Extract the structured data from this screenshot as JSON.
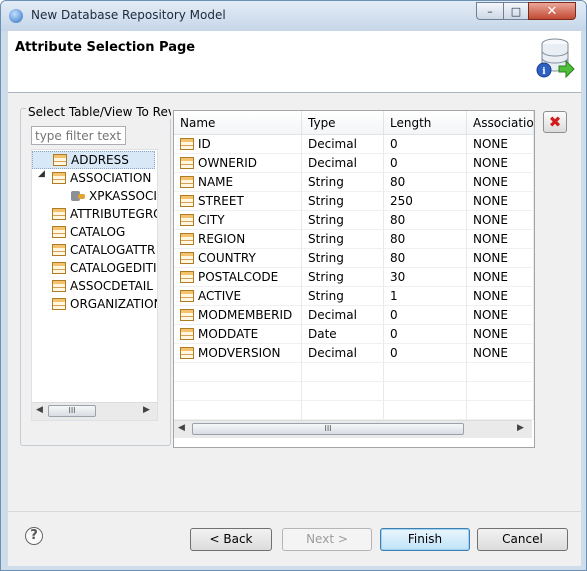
{
  "window": {
    "title": "New Database Repository Model",
    "controls": {
      "minimize": "–",
      "maximize": "□",
      "close": "✕"
    }
  },
  "header": {
    "page_title": "Attribute Selection Page"
  },
  "left_panel": {
    "group_label": "Select Table/View To Revi",
    "filter_placeholder": "type filter text",
    "tree": [
      {
        "label": "ADDRESS",
        "icon": "table-icon",
        "selected": true,
        "level": 0
      },
      {
        "label": "ASSOCIATION",
        "icon": "table-icon",
        "expanded": true,
        "level": 0
      },
      {
        "label": "XPKASSOCI",
        "icon": "key-index-icon",
        "level": 1
      },
      {
        "label": "ATTRIBUTEGRO",
        "icon": "table-icon",
        "level": 0
      },
      {
        "label": "CATALOG",
        "icon": "table-icon",
        "level": 0
      },
      {
        "label": "CATALOGATTR",
        "icon": "table-icon",
        "level": 0
      },
      {
        "label": "CATALOGEDITI",
        "icon": "table-icon",
        "level": 0
      },
      {
        "label": "ASSOCDETAIL",
        "icon": "table-icon",
        "level": 0
      },
      {
        "label": "ORGANIZATION",
        "icon": "table-icon",
        "level": 0
      }
    ],
    "scrollbar_grip": "III"
  },
  "table": {
    "columns": [
      "Name",
      "Type",
      "Length",
      "Association"
    ],
    "rows": [
      [
        "ID",
        "Decimal",
        "0",
        "NONE"
      ],
      [
        "OWNERID",
        "Decimal",
        "0",
        "NONE"
      ],
      [
        "NAME",
        "String",
        "80",
        "NONE"
      ],
      [
        "STREET",
        "String",
        "250",
        "NONE"
      ],
      [
        "CITY",
        "String",
        "80",
        "NONE"
      ],
      [
        "REGION",
        "String",
        "80",
        "NONE"
      ],
      [
        "COUNTRY",
        "String",
        "80",
        "NONE"
      ],
      [
        "POSTALCODE",
        "String",
        "30",
        "NONE"
      ],
      [
        "ACTIVE",
        "String",
        "1",
        "NONE"
      ],
      [
        "MODMEMBERID",
        "Decimal",
        "0",
        "NONE"
      ],
      [
        "MODDATE",
        "Date",
        "0",
        "NONE"
      ],
      [
        "MODVERSION",
        "Decimal",
        "0",
        "NONE"
      ]
    ],
    "scrollbar_grip": "III"
  },
  "remove_button": {
    "icon": "remove-red-x-icon",
    "glyph": "✖"
  },
  "footer": {
    "help": "?",
    "back": "< Back",
    "next": "Next >",
    "finish": "Finish",
    "cancel": "Cancel"
  },
  "colors": {
    "accent": "#3c7fb1",
    "selection": "#d9e8f7",
    "remove": "#d01c1c"
  }
}
